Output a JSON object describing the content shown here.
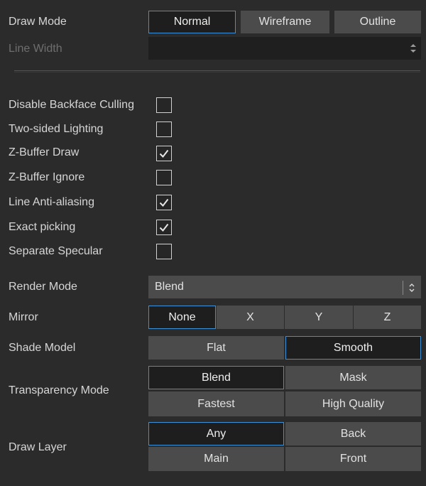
{
  "draw_mode": {
    "label": "Draw Mode",
    "options": [
      "Normal",
      "Wireframe",
      "Outline"
    ],
    "selected": "Normal"
  },
  "line_width": {
    "label": "Line Width",
    "value": ""
  },
  "checkboxes": [
    {
      "label": "Disable Backface Culling",
      "checked": false
    },
    {
      "label": "Two-sided Lighting",
      "checked": false
    },
    {
      "label": "Z-Buffer Draw",
      "checked": true
    },
    {
      "label": "Z-Buffer Ignore",
      "checked": false
    },
    {
      "label": "Line Anti-aliasing",
      "checked": true
    },
    {
      "label": "Exact picking",
      "checked": true
    },
    {
      "label": "Separate Specular",
      "checked": false
    }
  ],
  "render_mode": {
    "label": "Render Mode",
    "value": "Blend"
  },
  "mirror": {
    "label": "Mirror",
    "options": [
      "None",
      "X",
      "Y",
      "Z"
    ],
    "selected": "None"
  },
  "shade_model": {
    "label": "Shade Model",
    "options": [
      "Flat",
      "Smooth"
    ],
    "selected": "Smooth"
  },
  "transparency_mode": {
    "label": "Transparency Mode",
    "options": [
      "Blend",
      "Mask",
      "Fastest",
      "High Quality"
    ],
    "selected": "Blend"
  },
  "draw_layer": {
    "label": "Draw Layer",
    "options": [
      "Any",
      "Back",
      "Main",
      "Front"
    ],
    "selected": "Any"
  },
  "icons": {
    "spinner": "spinner-arrows-icon",
    "dropdown": "dropdown-arrows-icon",
    "check": "checkmark-icon"
  },
  "colors": {
    "background": "#2b2b2b",
    "button": "#4b4b4b",
    "selected_button": "#1e1e1e",
    "accent_border": "#3d8fd6"
  }
}
